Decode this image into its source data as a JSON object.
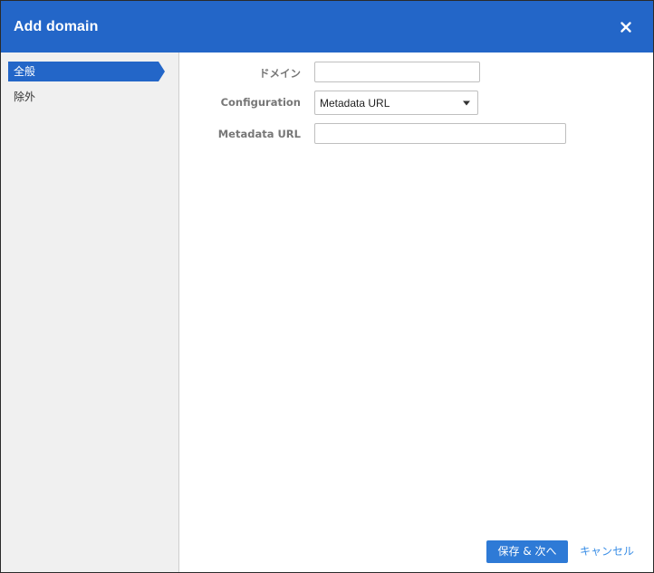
{
  "dialog": {
    "title": "Add domain",
    "close_icon": "close-icon"
  },
  "sidebar": {
    "items": [
      {
        "label": "全般",
        "active": true
      },
      {
        "label": "除外",
        "active": false
      }
    ]
  },
  "form": {
    "domain": {
      "label": "ドメイン",
      "value": "",
      "placeholder": ""
    },
    "configuration": {
      "label": "Configuration",
      "value": "Metadata URL"
    },
    "metadata_url": {
      "label": "Metadata URL",
      "value": "",
      "placeholder": ""
    }
  },
  "footer": {
    "save_next_label": "保存 & 次へ",
    "cancel_label": "キャンセル"
  },
  "colors": {
    "header_bg": "#2366c8",
    "active_nav_bg": "#2366c8",
    "primary_button": "#2e7ad6",
    "link": "#3a8ee6",
    "sidebar_bg": "#f0f0f0"
  }
}
